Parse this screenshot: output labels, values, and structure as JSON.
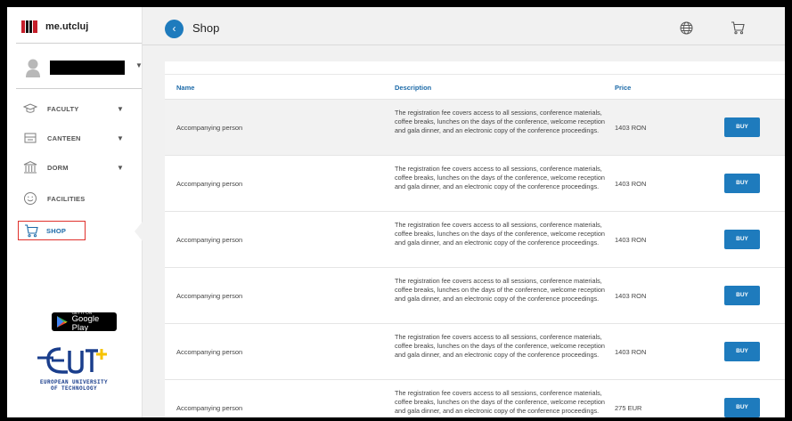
{
  "brand": {
    "name": "me.utcluj"
  },
  "user": {
    "name_redacted": true
  },
  "sidebar": {
    "items": [
      {
        "label": "FACULTY",
        "icon": "graduation-cap-icon",
        "has_caret": true
      },
      {
        "label": "CANTEEN",
        "icon": "canteen-icon",
        "has_caret": true
      },
      {
        "label": "DORM",
        "icon": "building-icon",
        "has_caret": true
      },
      {
        "label": "FACILITIES",
        "icon": "smiley-icon",
        "has_caret": false
      },
      {
        "label": "SHOP",
        "icon": "cart-icon",
        "has_caret": false,
        "active": true
      }
    ]
  },
  "store_badge": {
    "small": "GET IT ON",
    "big": "Google Play"
  },
  "eut": {
    "line1": "EUROPEAN UNIVERSITY",
    "line2": "OF TECHNOLOGY"
  },
  "header": {
    "title": "Shop",
    "back_icon": "chevron-left-icon"
  },
  "table": {
    "columns": {
      "name": "Name",
      "description": "Description",
      "price": "Price"
    },
    "rows": [
      {
        "name": "Accompanying person",
        "description": "The registration fee covers access to all sessions, conference materials, coffee breaks, lunches on the days of the conference, welcome reception and gala dinner, and an electronic copy of the conference proceedings.",
        "price": "1403 RON",
        "action": "BUY"
      },
      {
        "name": "Accompanying person",
        "description": "The registration fee covers access to all sessions, conference materials, coffee breaks, lunches on the days of the conference, welcome reception and gala dinner, and an electronic copy of the conference proceedings.",
        "price": "1403 RON",
        "action": "BUY"
      },
      {
        "name": "Accompanying person",
        "description": "The registration fee covers access to all sessions, conference materials, coffee breaks, lunches on the days of the conference, welcome reception and gala dinner, and an electronic copy of the conference proceedings.",
        "price": "1403 RON",
        "action": "BUY"
      },
      {
        "name": "Accompanying person",
        "description": "The registration fee covers access to all sessions, conference materials, coffee breaks, lunches on the days of the conference, welcome reception and gala dinner, and an electronic copy of the conference proceedings.",
        "price": "1403 RON",
        "action": "BUY"
      },
      {
        "name": "Accompanying person",
        "description": "The registration fee covers access to all sessions, conference materials, coffee breaks, lunches on the days of the conference, welcome reception and gala dinner, and an electronic copy of the conference proceedings.",
        "price": "1403 RON",
        "action": "BUY"
      },
      {
        "name": "Accompanying person",
        "description": "The registration fee covers access to all sessions, conference materials, coffee breaks, lunches on the days of the conference, welcome reception and gala dinner, and an electronic copy of the conference proceedings.",
        "price": "275 EUR",
        "action": "BUY"
      }
    ]
  },
  "colors": {
    "accent": "#1e7bbd",
    "active_border": "#e0312c",
    "eut_blue": "#1a3e8c",
    "eut_yellow": "#f6c300"
  }
}
